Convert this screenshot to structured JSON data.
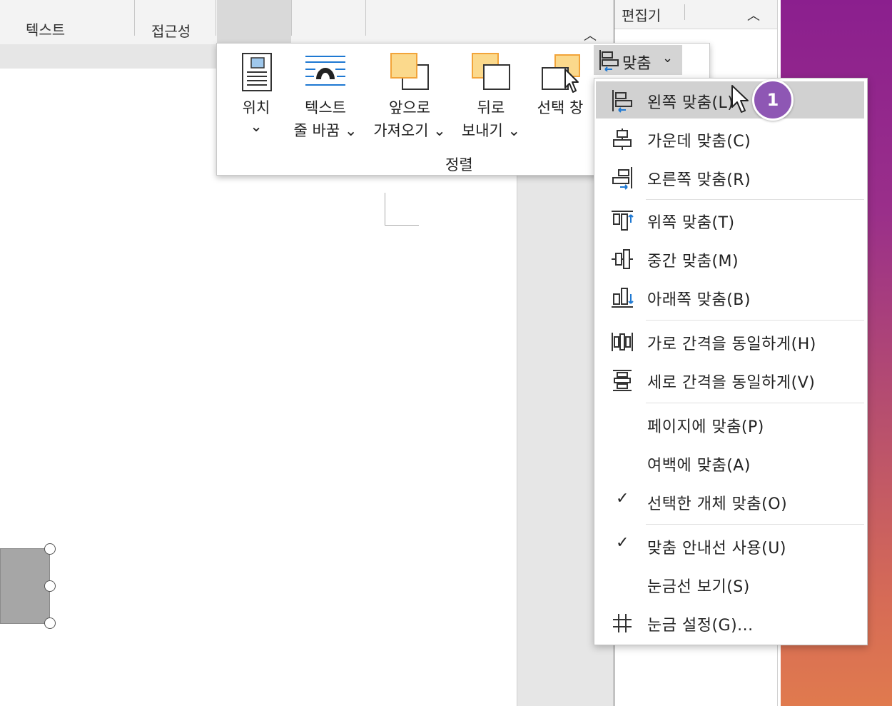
{
  "ribbon": {
    "tabs": [
      "텍스트",
      "접근성"
    ],
    "arrange": {
      "buttons": [
        {
          "line1": "위치",
          "line2": "⌄"
        },
        {
          "line1": "텍스트",
          "line2": "줄 바꿈 ⌄"
        },
        {
          "line1": "앞으로",
          "line2": "가져오기 ⌄"
        },
        {
          "line1": "뒤로",
          "line2": "보내기 ⌄"
        },
        {
          "line1": "선택 창",
          "line2": ""
        }
      ],
      "group_label": "정렬"
    },
    "align_button": {
      "label": "맞춤",
      "caret": "⌄"
    }
  },
  "side_pane": {
    "title": "편집기"
  },
  "align_menu": {
    "items": [
      {
        "label": "왼쪽 맞춤(L)",
        "icon": "align-left-icon",
        "highlighted": true
      },
      {
        "label": "가운데 맞춤(C)",
        "icon": "align-center-icon"
      },
      {
        "label": "오른쪽 맞춤(R)",
        "icon": "align-right-icon"
      },
      {
        "label": "위쪽 맞춤(T)",
        "icon": "align-top-icon"
      },
      {
        "label": "중간 맞춤(M)",
        "icon": "align-middle-icon"
      },
      {
        "label": "아래쪽 맞춤(B)",
        "icon": "align-bottom-icon"
      },
      {
        "label": "가로 간격을 동일하게(H)",
        "icon": "distribute-horizontal-icon"
      },
      {
        "label": "세로 간격을 동일하게(V)",
        "icon": "distribute-vertical-icon"
      },
      {
        "label": "페이지에 맞춤(P)",
        "icon": ""
      },
      {
        "label": "여백에 맞춤(A)",
        "icon": ""
      },
      {
        "label": "선택한 개체 맞춤(O)",
        "icon": "check-icon",
        "checked": true
      },
      {
        "label": "맞춤 안내선 사용(U)",
        "icon": "check-icon",
        "checked": true
      },
      {
        "label": "눈금선 보기(S)",
        "icon": ""
      },
      {
        "label": "눈금 설정(G)...",
        "icon": "grid-icon"
      }
    ]
  },
  "badge": {
    "number": "1",
    "color": "#8e57b4"
  },
  "colors": {
    "accent_blue": "#1e78d2",
    "highlight": "#d1d1d1",
    "icon_orange": "#f2a43a",
    "icon_fill": "#fbd98c"
  }
}
